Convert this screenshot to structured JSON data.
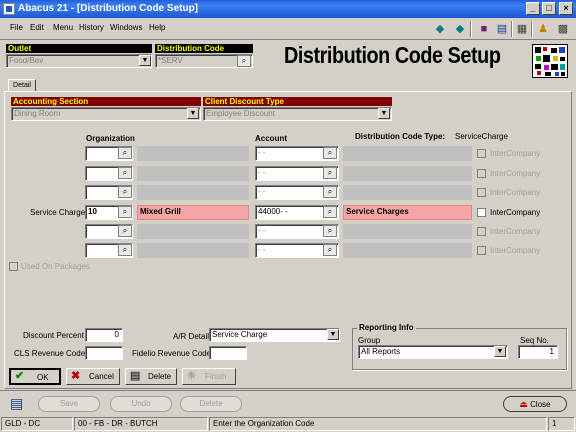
{
  "window": {
    "title": "Abacus 21 - [Distribution Code Setup]"
  },
  "menu": {
    "items": [
      "File",
      "Edit",
      "Menu",
      "History",
      "Windows",
      "Help"
    ]
  },
  "header": {
    "outlet_label": "Outlet",
    "outlet_value": "Food/Bev",
    "distcode_label": "Distribution Code",
    "distcode_value": "*SERV",
    "page_title": "Distribution Code Setup"
  },
  "tab": {
    "label": "Detail"
  },
  "sections": {
    "accounting_label": "Accounting Section",
    "accounting_value": "Dining Room",
    "client_discount_label": "Client Discount Type",
    "client_discount_value": "Employee Discount"
  },
  "grid": {
    "org_header": "Organization",
    "account_header": "Account",
    "dct_label": "Distribution Code Type:",
    "dct_value": "ServiceCharge",
    "rows": [
      {
        "label": "",
        "org": "",
        "org_name": "",
        "account": "- -",
        "account_name": "",
        "intercompany": "InterCompany",
        "active": false
      },
      {
        "label": "",
        "org": "",
        "org_name": "",
        "account": "- -",
        "account_name": "",
        "intercompany": "InterCompany",
        "active": false
      },
      {
        "label": "",
        "org": "",
        "org_name": "",
        "account": "- -",
        "account_name": "",
        "intercompany": "InterCompany",
        "active": false
      },
      {
        "label": "Service Charge",
        "org": "10",
        "org_name": "Mixed Grill",
        "account": "44000-  -",
        "account_name": "Service Charges",
        "intercompany": "InterCompany",
        "active": true
      },
      {
        "label": "",
        "org": "",
        "org_name": "",
        "account": "- -",
        "account_name": "",
        "intercompany": "InterCompany",
        "active": false
      },
      {
        "label": "",
        "org": "",
        "org_name": "",
        "account": "- -",
        "account_name": "",
        "intercompany": "InterCompany",
        "active": false
      }
    ]
  },
  "used_on_packages": "Used On Packages",
  "bottom": {
    "discount_percent_label": "Discount Percent",
    "discount_percent_value": "0",
    "cls_revenue_label": "CLS Revenue Code",
    "cls_revenue_value": "",
    "ar_detail_label": "A/R Detail",
    "ar_detail_value": "Service Charge",
    "fidelio_label": "Fidelio Revenue Code",
    "fidelio_value": "",
    "reporting_title": "Reporting Info",
    "group_label": "Group",
    "group_value": "All Reports",
    "seq_label": "Seq No.",
    "seq_value": "1"
  },
  "buttons": {
    "ok": "OK",
    "cancel": "Cancel",
    "delete": "Delete",
    "finish": "Finish"
  },
  "nav_buttons": {
    "save": "Save",
    "undo": "Undo",
    "delete": "Delete",
    "close": "Close"
  },
  "status": {
    "cell1": "GLD - DC",
    "cell2": "00 - FB - DR - BUTCH",
    "cell3": "Enter the Organization Code",
    "cell4": "1"
  }
}
